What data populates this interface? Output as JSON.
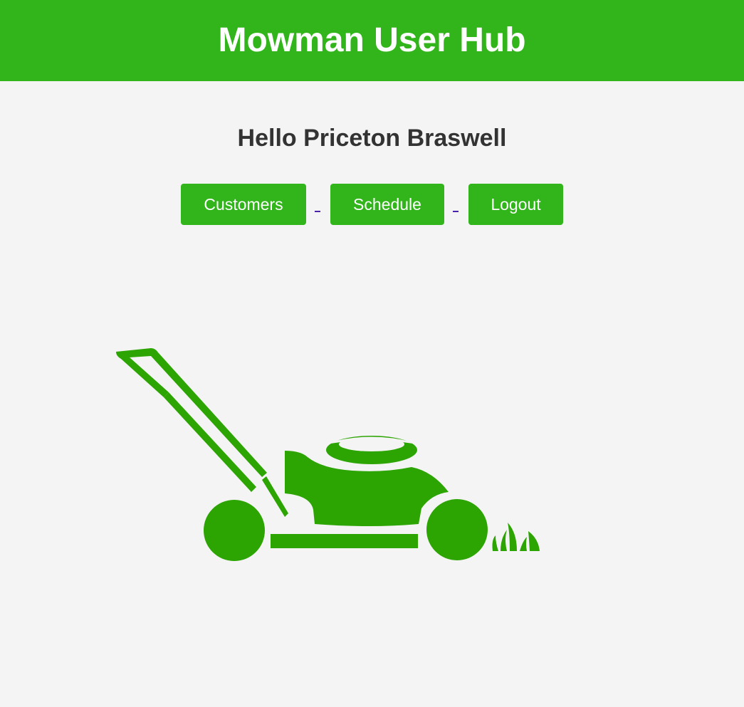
{
  "header": {
    "title": "Mowman User Hub"
  },
  "greeting": "Hello Priceton Braswell",
  "nav": {
    "customers_label": "Customers",
    "schedule_label": "Schedule",
    "logout_label": "Logout"
  },
  "colors": {
    "brand_green": "#31b51b",
    "mower_green": "#2ca402",
    "background": "#f4f4f4",
    "text_dark": "#333333"
  },
  "illustration": {
    "icon": "lawn-mower-icon"
  }
}
